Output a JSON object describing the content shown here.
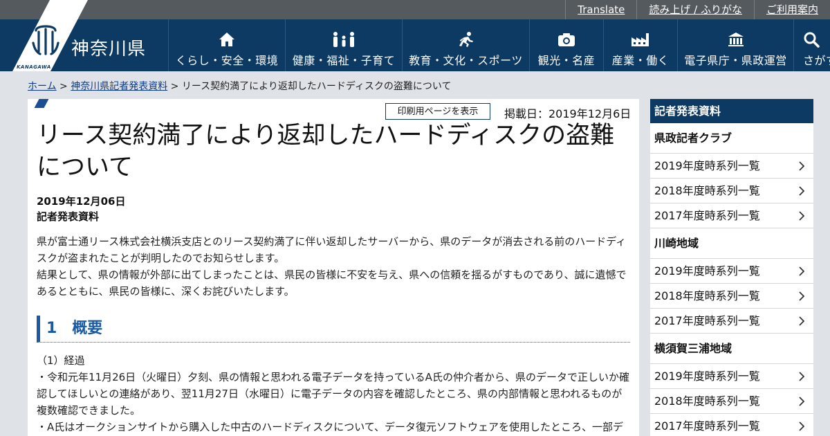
{
  "utility_links": [
    "Translate",
    "読み上げ / ふりがな",
    "ご利用案内"
  ],
  "header": {
    "pref_name": "神奈川県",
    "pref_kana": "KANAGAWA",
    "nav": [
      {
        "label": "くらし・安全・環境",
        "icon": "house-icon"
      },
      {
        "label": "健康・福祉・子育て",
        "icon": "family-icon"
      },
      {
        "label": "教育・文化・スポーツ",
        "icon": "runner-icon"
      },
      {
        "label": "観光・名産",
        "icon": "camera-icon"
      },
      {
        "label": "産業・働く",
        "icon": "factory-icon"
      },
      {
        "label": "電子県庁・県政運営",
        "icon": "government-building-icon"
      },
      {
        "label": "さがす",
        "icon": "search-icon"
      }
    ]
  },
  "breadcrumb": {
    "home": "ホーム",
    "sep1": " > ",
    "parent": "神奈川県記者発表資料",
    "sep2": " > ",
    "current": "リース契約満了により返却したハードディスクの盗難について"
  },
  "article": {
    "print_label": "印刷用ページを表示",
    "published": "掲載日：2019年12月6日",
    "title": "リース契約満了により返却したハードディスクの盗難について",
    "date": "2019年12月06日",
    "type": "記者発表資料",
    "lead_1": "県が富士通リース株式会社横浜支店とのリース契約満了に伴い返却したサーバーから、県のデータが消去される前のハードディスクが盗まれたことが判明したのでお知らせします。",
    "lead_2": "結果として、県の情報が外部に出てしまったことは、県民の皆様に不安を与え、県への信頼を揺るがすものであり、誠に遺憾であるとともに、県民の皆様に、深くお詫びいたします。",
    "section_title": "1　概要",
    "subsection": "（1）経過",
    "bullet_1": "・令和元年11月26日（火曜日）夕刻、県の情報と思われる電子データを持っているA氏の仲介者から、県のデータで正しいか確認してほしいとの連絡があり、翌11月27日（水曜日）に電子データの内容を確認したところ、県の内部情報と思われるものが複数確認できました。",
    "bullet_2": "・A氏はオークションサイトから購入した中古のハードディスクについて、データ復元ソフトウェアを使用したところ、一部デ"
  },
  "sidebar": {
    "header": "記者発表資料",
    "groups": [
      {
        "title": "県政記者クラブ",
        "items": [
          "2019年度時系列一覧",
          "2018年度時系列一覧",
          "2017年度時系列一覧"
        ]
      },
      {
        "title": "川崎地域",
        "items": [
          "2019年度時系列一覧",
          "2018年度時系列一覧",
          "2017年度時系列一覧"
        ]
      },
      {
        "title": "横須賀三浦地域",
        "items": [
          "2019年度時系列一覧",
          "2018年度時系列一覧",
          "2017年度時系列一覧"
        ]
      }
    ]
  },
  "colors": {
    "navy": "#0c3a62",
    "utility_gray": "#555a5f",
    "accent_blue": "#1a5aa4",
    "page_bg": "#dfe3e8"
  }
}
